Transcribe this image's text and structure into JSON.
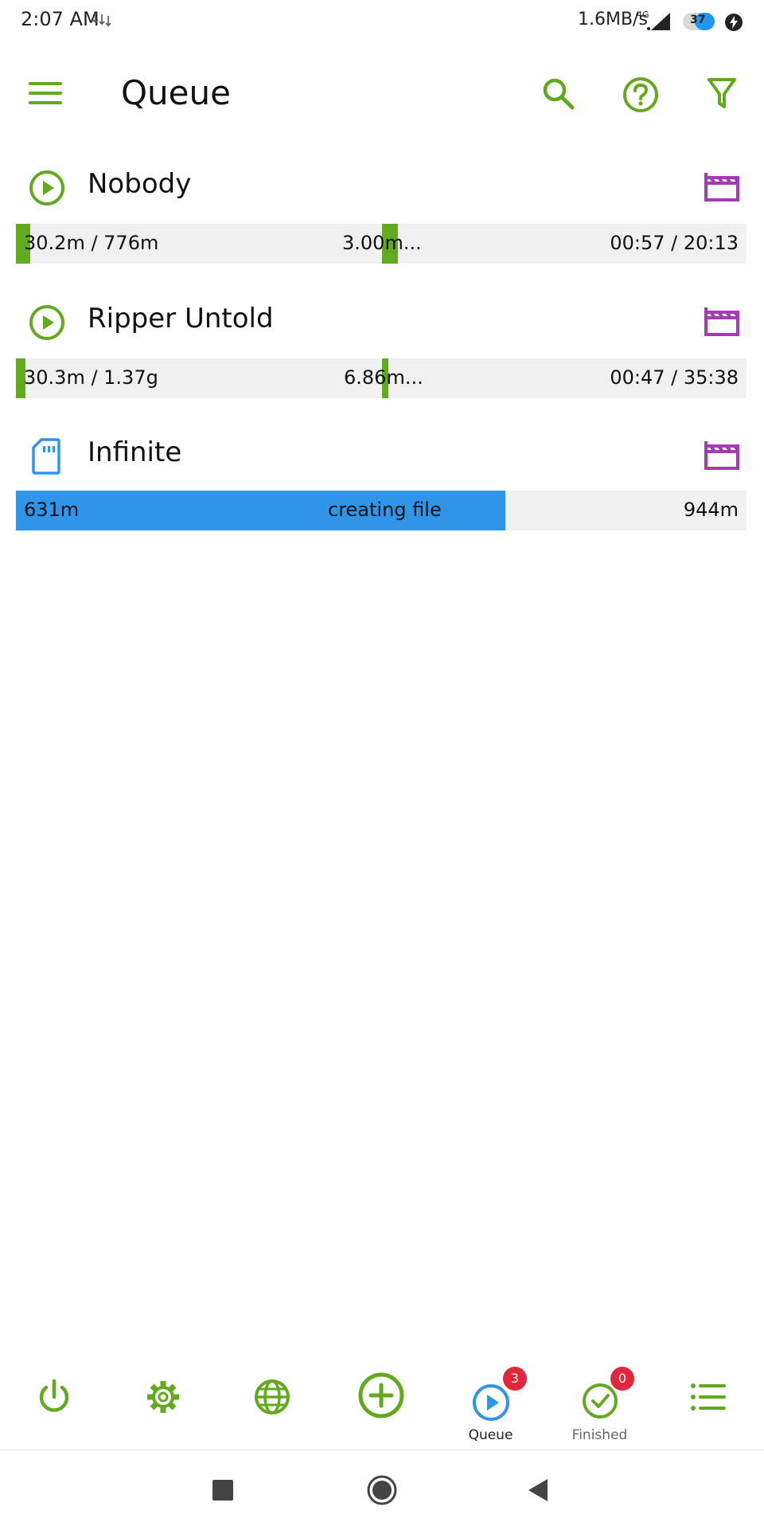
{
  "status_bar": {
    "time": "2:07 AM",
    "speed": "1.6MB/s",
    "network": "4G",
    "battery": "37",
    "battery_level_percent": 37
  },
  "app_bar": {
    "title": "Queue",
    "icons": [
      "menu-icon",
      "search-icon",
      "help-icon",
      "filter-icon"
    ]
  },
  "queue": [
    {
      "title": "Nobody",
      "status_icon": "play-icon",
      "type_icon": "film-icon",
      "size": "30.2m / 776m",
      "speed": "3.00m...",
      "time": "00:57 / 20:13"
    },
    {
      "title": "Ripper Untold",
      "status_icon": "play-icon",
      "type_icon": "film-icon",
      "size": "30.3m / 1.37g",
      "speed": "6.86m...",
      "time": "00:47 / 35:38"
    },
    {
      "title": "Infinite",
      "status_icon": "sd-card-icon",
      "type_icon": "film-icon",
      "size": "631m",
      "status": "creating file",
      "total": "944m",
      "progress_percent": 67
    }
  ],
  "bottom_nav": [
    {
      "icon": "power-icon"
    },
    {
      "icon": "settings-icon"
    },
    {
      "icon": "globe-icon"
    },
    {
      "icon": "add-icon"
    },
    {
      "icon": "queue-play-icon",
      "label": "Queue",
      "badge": "3"
    },
    {
      "icon": "check-icon",
      "label": "Finished",
      "badge": "0"
    },
    {
      "icon": "list-icon"
    }
  ],
  "colors": {
    "accent_green": "#63a91f",
    "film_purple": "#a53ab5",
    "progress_blue": "#2f95e8",
    "badge_red": "#e0273b"
  }
}
